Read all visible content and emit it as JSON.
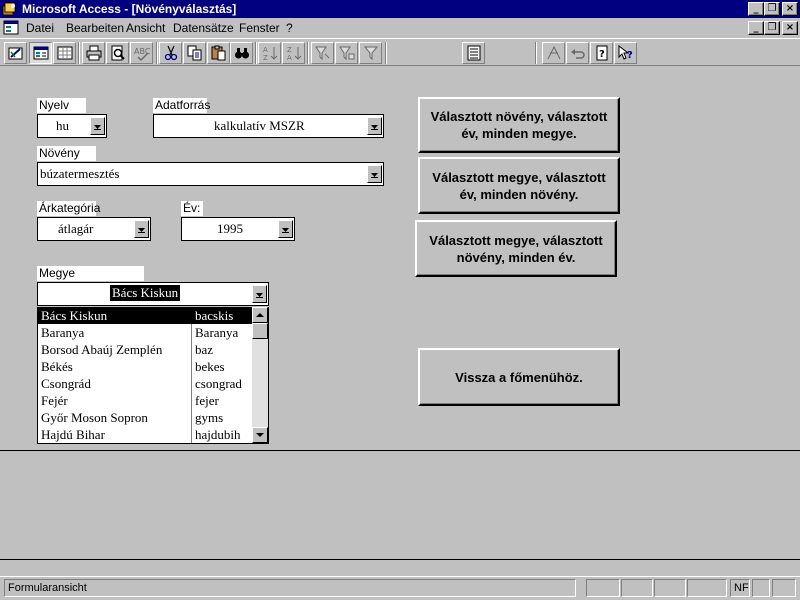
{
  "window": {
    "title": "Microsoft Access - [Növényválasztás]",
    "app_icon": "access-key-icon"
  },
  "menubar": {
    "items": [
      "Datei",
      "Bearbeiten",
      "Ansicht",
      "Datensätze",
      "Fenster",
      "?"
    ]
  },
  "toolbar": {
    "buttons": [
      "design-view-icon",
      "form-view-icon",
      "datasheet-view-icon",
      "print-icon",
      "print-preview-icon",
      "spelling-icon",
      "cut-icon",
      "copy-icon",
      "paste-icon",
      "find-icon",
      "sort-ascending-icon",
      "sort-descending-icon",
      "filter-by-selection-icon",
      "filter-by-form-icon",
      "apply-filter-icon",
      "database-window-icon",
      "new-object-icon",
      "undo-icon",
      "help-icon",
      "whats-this-icon"
    ]
  },
  "form": {
    "nyelv": {
      "label": "Nyelv",
      "value": "hu"
    },
    "adatforras": {
      "label": "Adatforrás",
      "value": "kalkulatív MSZR"
    },
    "noveny": {
      "label": "Növény",
      "value": "búzatermesztés"
    },
    "arkategoria": {
      "label": "Árkategória",
      "value": "átlagár"
    },
    "ev": {
      "label": "Év:",
      "value": "1995"
    },
    "megye": {
      "label": "Megye",
      "value": "Bács Kiskun",
      "rows": [
        {
          "name": "Bács Kiskun",
          "code": "bacskis",
          "selected": true
        },
        {
          "name": "Baranya",
          "code": "Baranya",
          "selected": false
        },
        {
          "name": "Borsod Abaúj Zemplén",
          "code": "baz",
          "selected": false
        },
        {
          "name": "Békés",
          "code": "bekes",
          "selected": false
        },
        {
          "name": "Csongrád",
          "code": "csongrad",
          "selected": false
        },
        {
          "name": "Fejér",
          "code": "fejer",
          "selected": false
        },
        {
          "name": "Győr Moson Sopron",
          "code": "gyms",
          "selected": false
        },
        {
          "name": "Hajdú Bihar",
          "code": "hajdubih",
          "selected": false
        }
      ]
    },
    "buttons": {
      "btn1": "Választott növény, választott év, minden megye.",
      "btn2": "Választott megye, választott év, minden növény.",
      "btn3": "Választott megye, választott növény, minden év.",
      "btn4": "Vissza a főmenühöz."
    }
  },
  "statusbar": {
    "text": "Formularansicht",
    "nf": "NF"
  }
}
